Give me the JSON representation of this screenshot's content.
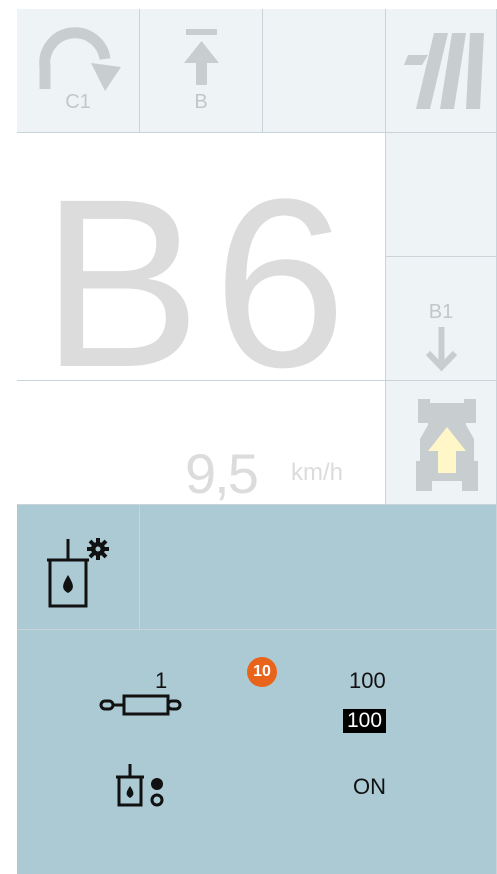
{
  "top_bar": {
    "turn_label": "C1",
    "lift_label": "B"
  },
  "main": {
    "gear_letter": "B",
    "gear_number": "6",
    "speed_value": "9,5",
    "speed_unit": "km/h",
    "shift_down_label": "B1"
  },
  "hydraulics": {
    "valve_number": "1",
    "alert_count": "10",
    "flow_value": "100",
    "flow_setpoint": "100",
    "pump_status": "ON"
  },
  "colors": {
    "panel_blue": "#abcad3",
    "badge_orange": "#e8641b",
    "top_bar": "#eef3f6"
  }
}
